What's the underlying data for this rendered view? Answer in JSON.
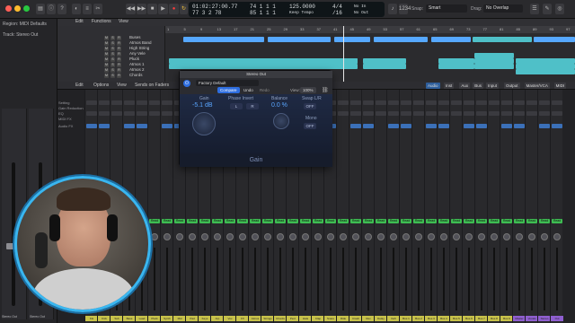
{
  "colors": {
    "accent": "#2e6ee0",
    "region_blue": "#56a8ff",
    "region_cyan": "#4fc0c8",
    "cam_ring": "#39b6f0",
    "read_green": "#3ebc52",
    "name_yellow": "#c8c24a"
  },
  "control_bar": {
    "lcd": {
      "time": "01:02:27:00.77",
      "bars": "77 3 2 78",
      "pos1": "74 1 1 1",
      "pos2": "85 1 1 1",
      "tempo": "125.0000",
      "tempo_label": "Keep Tempo",
      "sig": "4/4",
      "div": "/16",
      "in": "No In",
      "out": "No Out"
    },
    "snap_label": "Snap:",
    "snap_value": "Smart",
    "drag_label": "Drag:",
    "drag_value": "No Overlap",
    "badge": "o64"
  },
  "inspector": {
    "region": "Region: MIDI Defaults",
    "track": "Track: Stereo Out",
    "rows": [
      "Setting",
      "Gain Reduction",
      "EQ",
      "MIDI FX",
      "Audio FX"
    ],
    "strips": [
      {
        "name": "Stereo Out"
      },
      {
        "name": "Stereo Out"
      }
    ]
  },
  "tracks_area": {
    "toolbar": [
      "Edit",
      "Functions",
      "View"
    ],
    "ruler": [
      "1",
      "5",
      "9",
      "13",
      "17",
      "21",
      "25",
      "29",
      "33",
      "37",
      "41",
      "45",
      "49",
      "53",
      "57",
      "61",
      "65",
      "69",
      "73",
      "77",
      "81",
      "85",
      "89",
      "93",
      "97"
    ],
    "tracks": [
      "Buses",
      "Atmos Band",
      "High String",
      "Any Vele",
      "Pluck",
      "Atmos 1",
      "Atmos 2",
      "Chords"
    ]
  },
  "mixer": {
    "menu": [
      "Edit",
      "Options",
      "View",
      "Sends on Faders"
    ],
    "filters": [
      "Audio",
      "Inst",
      "Aux",
      "Bus",
      "Input",
      "Output",
      "Master/VCA",
      "MIDI"
    ],
    "active_filter": "Audio",
    "side_labels": [
      "Setting",
      "Gain Reduction",
      "EQ",
      "MIDI FX",
      "Audio FX"
    ],
    "strips": [
      {
        "name": "Kik",
        "mode": "Read"
      },
      {
        "name": "Kick",
        "mode": "Read"
      },
      {
        "name": "Sub",
        "mode": "Read"
      },
      {
        "name": "Bass",
        "mode": "Read"
      },
      {
        "name": "Lead",
        "mode": "Read"
      },
      {
        "name": "Pluck",
        "mode": "Read"
      },
      {
        "name": "Synth",
        "mode": "Read"
      },
      {
        "name": "Mid",
        "mode": "Read"
      },
      {
        "name": "Pad",
        "mode": "Read"
      },
      {
        "name": "Keys",
        "mode": "Read"
      },
      {
        "name": "Arp",
        "mode": "Read"
      },
      {
        "name": "Vox",
        "mode": "Read"
      },
      {
        "name": "FX",
        "mode": "Read"
      },
      {
        "name": "Atmos",
        "mode": "Read"
      },
      {
        "name": "Strings",
        "mode": "Read"
      },
      {
        "name": "Chords",
        "mode": "Read"
      },
      {
        "name": "Perc",
        "mode": "Read"
      },
      {
        "name": "Hats",
        "mode": "Read"
      },
      {
        "name": "Clap",
        "mode": "Read"
      },
      {
        "name": "Snare",
        "mode": "Read"
      },
      {
        "name": "Ride",
        "mode": "Read"
      },
      {
        "name": "Crash",
        "mode": "Read"
      },
      {
        "name": "Rev",
        "mode": "Read"
      },
      {
        "name": "Delay",
        "mode": "Read"
      },
      {
        "name": "Verb",
        "mode": "Read"
      },
      {
        "name": "Bus 1",
        "mode": "Read"
      },
      {
        "name": "Bus 2",
        "mode": "Read"
      },
      {
        "name": "Bus 3",
        "mode": "Read"
      },
      {
        "name": "Bus 4",
        "mode": "Read"
      },
      {
        "name": "Bus 5",
        "mode": "Read"
      },
      {
        "name": "Bus 6",
        "mode": "Read"
      },
      {
        "name": "Bus 7",
        "mode": "Read"
      },
      {
        "name": "Bus 8",
        "mode": "Read"
      },
      {
        "name": "Bus 9",
        "mode": "Read"
      },
      {
        "name": "Master",
        "mode": "Read"
      },
      {
        "name": "Vocals",
        "mode": "Read"
      },
      {
        "name": "Stereo",
        "mode": "Read"
      },
      {
        "name": "Out",
        "mode": "Read"
      }
    ]
  },
  "plugin": {
    "title": "Stereo Out",
    "preset": "Factory Default",
    "compare": "Compare",
    "undo": "Undo",
    "redo": "Redo",
    "view_label": "View:",
    "view_value": "100%",
    "gain_label": "Gain",
    "gain_value": "-5.1 dB",
    "phase_label": "Phase Invert",
    "phase_l": "L",
    "phase_r": "R",
    "balance_label": "Balance",
    "balance_value": "0.0 %",
    "swap_label": "Swap L/R",
    "swap_value": "OFF",
    "mono_label": "Mono",
    "mono_value": "OFF",
    "footer": "Gain"
  }
}
